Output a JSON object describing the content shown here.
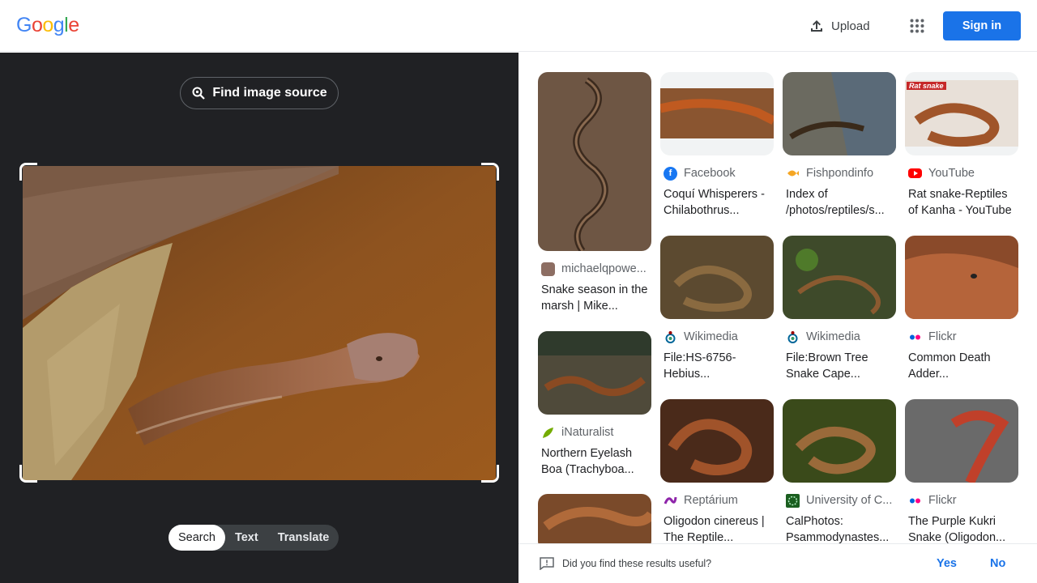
{
  "header": {
    "logo_letters": [
      "G",
      "o",
      "o",
      "g",
      "l",
      "e"
    ],
    "logo_colors": [
      "#4285f4",
      "#ea4335",
      "#fbbc05",
      "#4285f4",
      "#34a853",
      "#ea4335"
    ],
    "upload_label": "Upload",
    "apps_icon": "apps-grid-icon",
    "signin_label": "Sign in"
  },
  "left_panel": {
    "find_source_label": "Find image source",
    "modes": [
      {
        "label": "Search",
        "active": true
      },
      {
        "label": "Text",
        "active": false
      },
      {
        "label": "Translate",
        "active": false
      }
    ]
  },
  "results": [
    {
      "source": "michaelqpowe...",
      "title": "Snake season in the marsh | Mike...",
      "icon": "avatar"
    },
    {
      "source": "iNaturalist",
      "title": "Northern Eyelash Boa (Trachyboa...",
      "icon": "leaf"
    },
    {
      "source": "Facebook",
      "title": "Coquí Whisperers - Chilabothrus...",
      "icon": "f"
    },
    {
      "source": "Wikimedia",
      "title": "File:HS-6756-Hebius...",
      "icon": "wiki"
    },
    {
      "source": "Reptárium",
      "title": "Oligodon cinereus | The Reptile...",
      "icon": "rep"
    },
    {
      "source": "Fishpondinfo",
      "title": "Index of /photos/reptiles/s...",
      "icon": "fish"
    },
    {
      "source": "Wikimedia",
      "title": "File:Brown Tree Snake Cape...",
      "icon": "wiki"
    },
    {
      "source": "University of C...",
      "title": "CalPhotos: Psammodynastes...",
      "icon": "uc"
    },
    {
      "source": "YouTube",
      "title": "Rat snake-Reptiles of Kanha - YouTube",
      "icon": "yt",
      "overlay": "Rat snake"
    },
    {
      "source": "Flickr",
      "title": "Common Death Adder...",
      "icon": "flickr"
    },
    {
      "source": "Flickr",
      "title": "The Purple Kukri Snake (Oligodon...",
      "icon": "flickr"
    }
  ],
  "feedback": {
    "question": "Did you find these results useful?",
    "yes_label": "Yes",
    "no_label": "No"
  },
  "colors": {
    "accent": "#1a73e8",
    "dark_panel": "#202124",
    "facebook": "#1877f2",
    "youtube": "#ff0000"
  }
}
